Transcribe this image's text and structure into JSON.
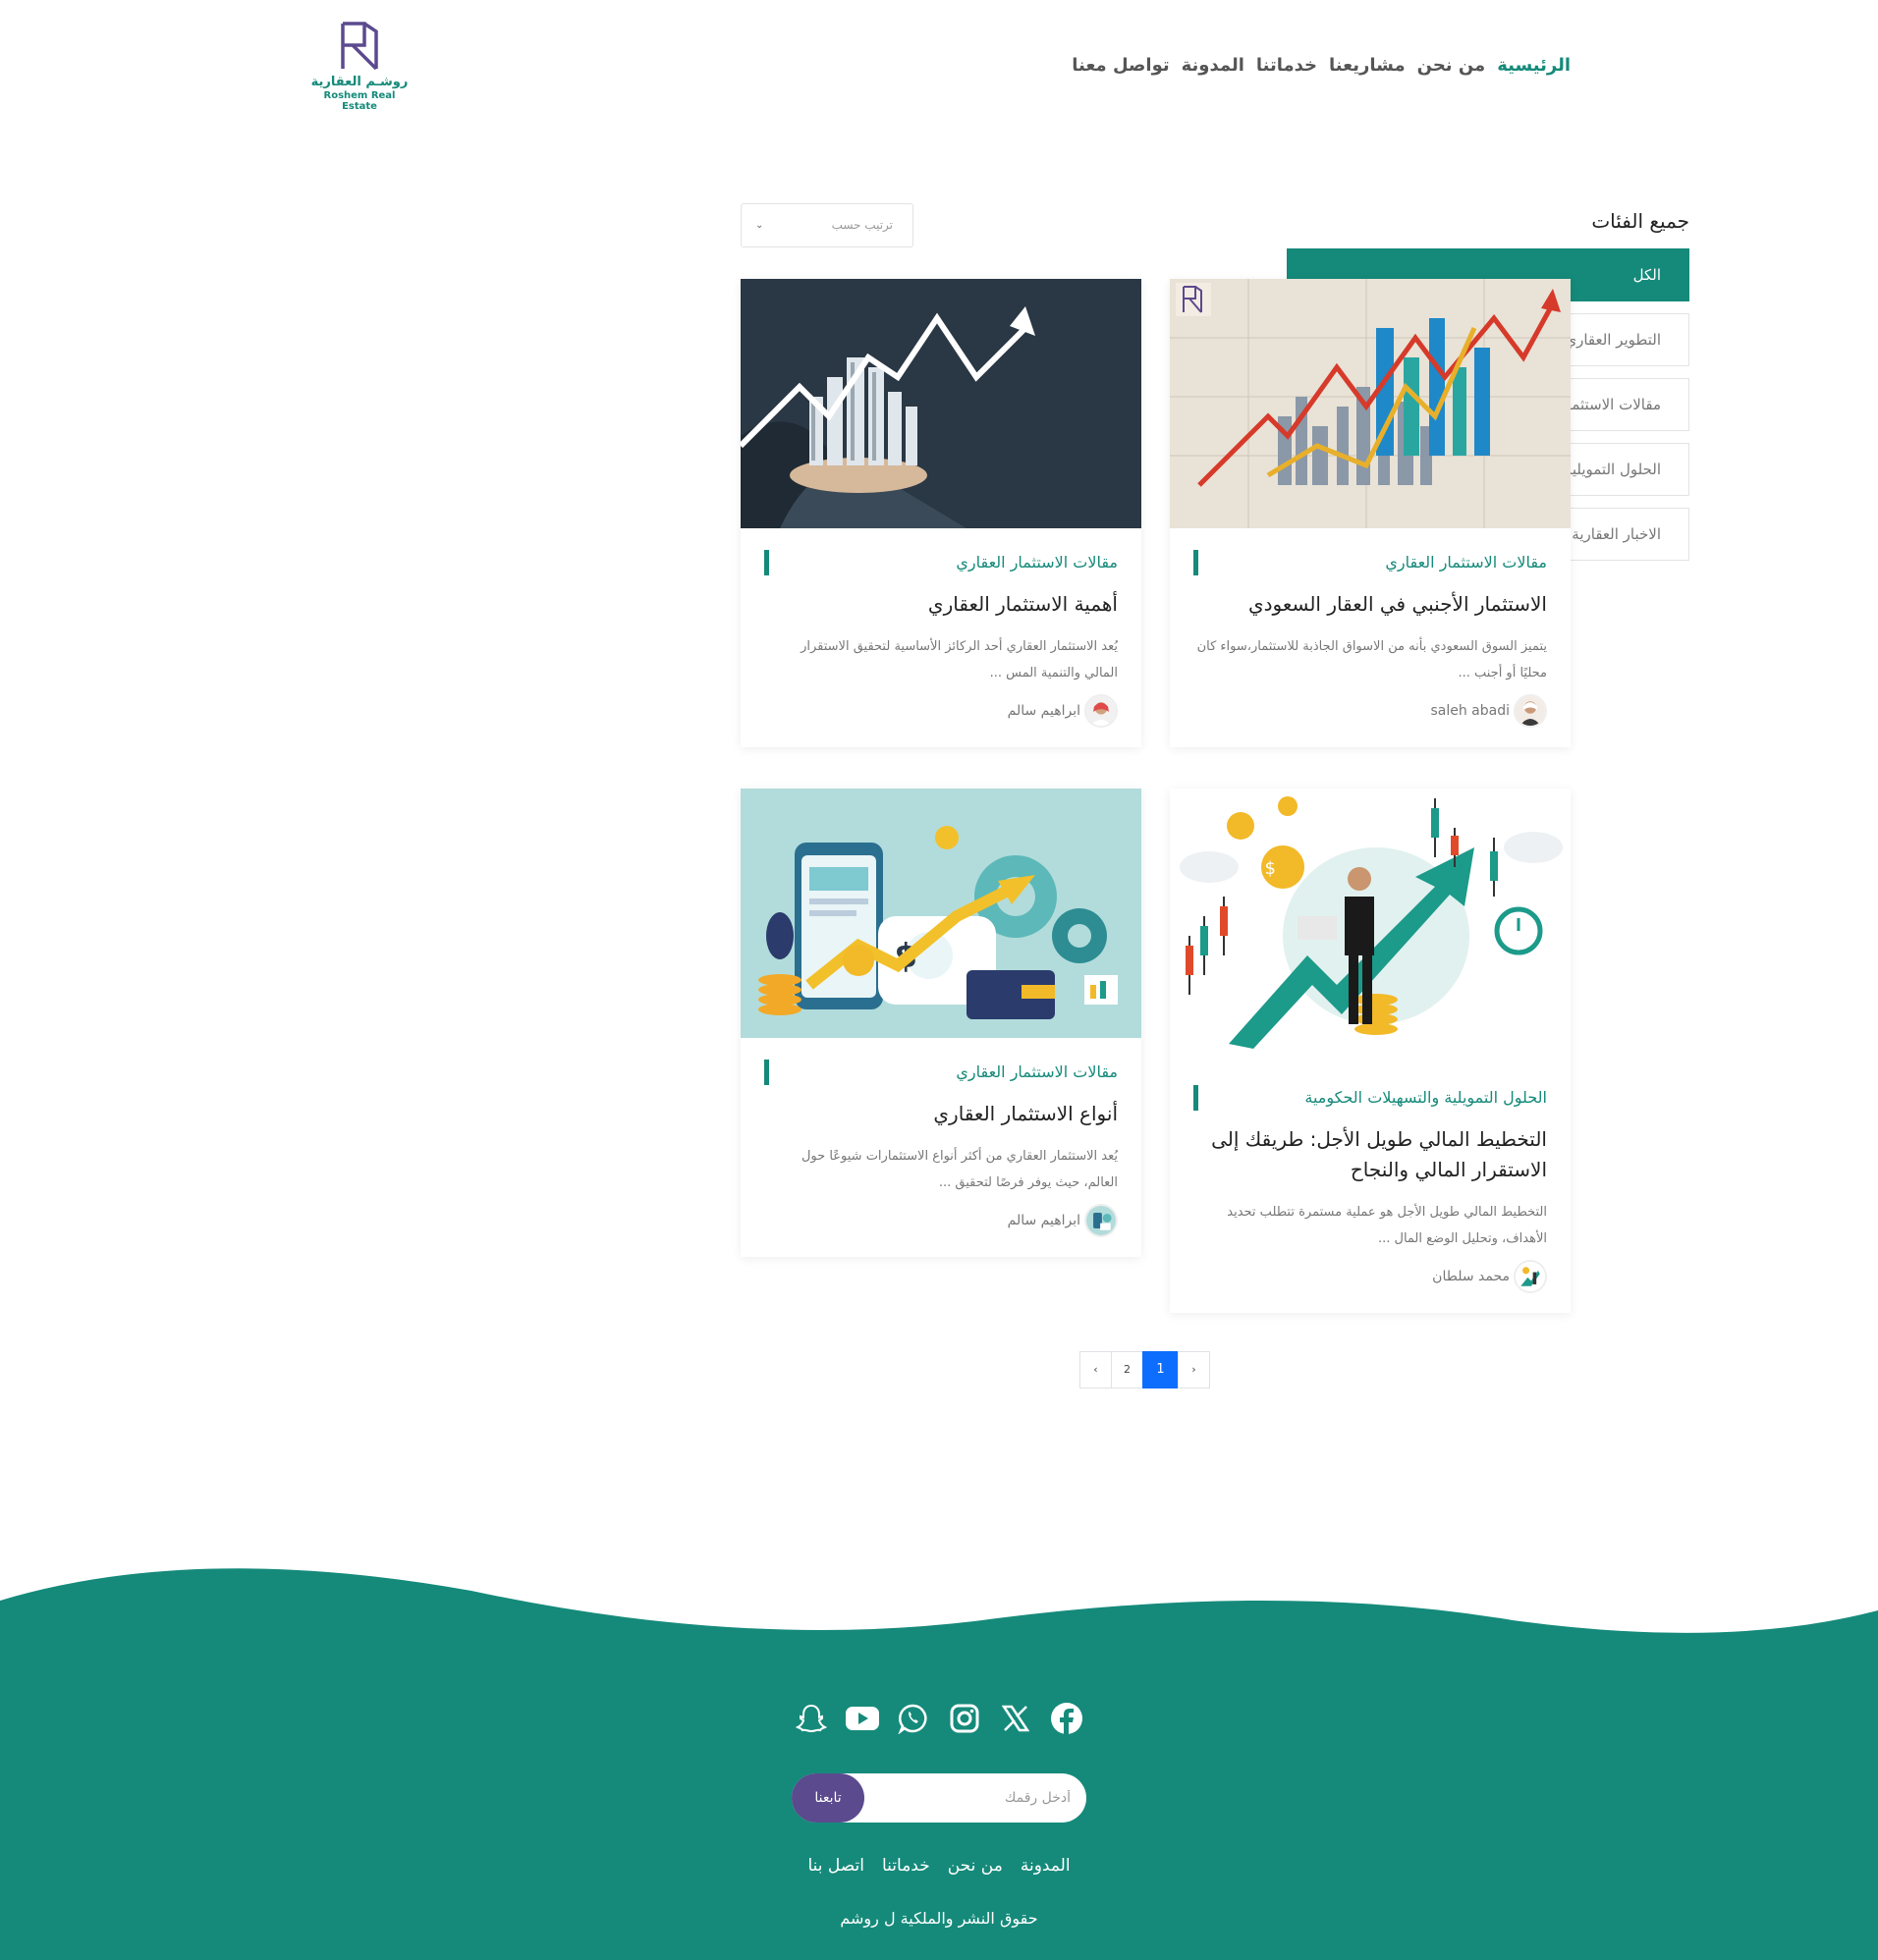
{
  "brand": {
    "name_ar": "روشـم العقارية",
    "name_en": "Roshem Real Estate",
    "primary_color": "#158a7a",
    "accent_color": "#5b4a8e"
  },
  "nav": {
    "items": [
      {
        "label": "الرئيسية",
        "active": true
      },
      {
        "label": "من نحن",
        "active": false
      },
      {
        "label": "مشاريعنا",
        "active": false
      },
      {
        "label": "خدماتنا",
        "active": false
      },
      {
        "label": "المدونة",
        "active": false
      },
      {
        "label": "تواصل معنا",
        "active": false
      }
    ]
  },
  "sidebar": {
    "title": "جميع الفئات",
    "categories": [
      {
        "label": "الكل",
        "active": true
      },
      {
        "label": "التطوير العقاري",
        "active": false
      },
      {
        "label": "مقالات الاستثمار العقاري",
        "active": false
      },
      {
        "label": "الحلول التمويلية والتسهيلات الحكومية",
        "active": false
      },
      {
        "label": "الاخبار العقارية والقوانين المستحدثة",
        "active": false
      }
    ]
  },
  "sort": {
    "selected": "ترتيب حسب",
    "icon": "chevron-down-icon"
  },
  "posts": [
    {
      "category": "مقالات الاستثمار العقاري",
      "title": "الاستثمار الأجنبي في العقار السعودي",
      "excerpt": "يتميز السوق السعودي بأنه من الاسواق الجاذبة للاستثمار،سواء كان محليًا أو أجنب ...",
      "author": "saleh abadi"
    },
    {
      "category": "مقالات الاستثمار العقاري",
      "title": "أهمية الاستثمار العقاري",
      "excerpt": "يُعد الاستثمار العقاري أحد الركائز الأساسية لتحقيق الاستقرار المالي والتنمية المس ...",
      "author": "ابراهيم سالم"
    },
    {
      "category": "الحلول التمويلية والتسهيلات الحكومية",
      "title": "التخطيط المالي طويل الأجل: طريقك إلى الاستقرار المالي والنجاح",
      "excerpt": "التخطيط المالي طويل الأجل هو عملية مستمرة تتطلب تحديد الأهداف، وتحليل الوضع المال ...",
      "author": "محمد سلطان"
    },
    {
      "category": "مقالات الاستثمار العقاري",
      "title": "أنواع الاستثمار العقاري",
      "excerpt": "يُعد الاستثمار العقاري من أكثر أنواع الاستثمارات شيوعًا حول العالم، حيث يوفر فرصًا لتحقيق ...",
      "author": "ابراهيم سالم"
    }
  ],
  "pagination": {
    "prev": "‹",
    "pages": [
      "1",
      "2"
    ],
    "current": "1",
    "next": "›"
  },
  "footer": {
    "socials": [
      "snapchat-icon",
      "youtube-icon",
      "whatsapp-icon",
      "instagram-icon",
      "x-icon",
      "facebook-icon"
    ],
    "newsletter_placeholder": "أدخل رقمك",
    "follow_label": "تابعنا",
    "links": [
      "المدونة",
      "من نحن",
      "خدماتنا",
      "اتصل بنا"
    ],
    "copyright": "حقوق النشر والملكية ل روشم"
  }
}
